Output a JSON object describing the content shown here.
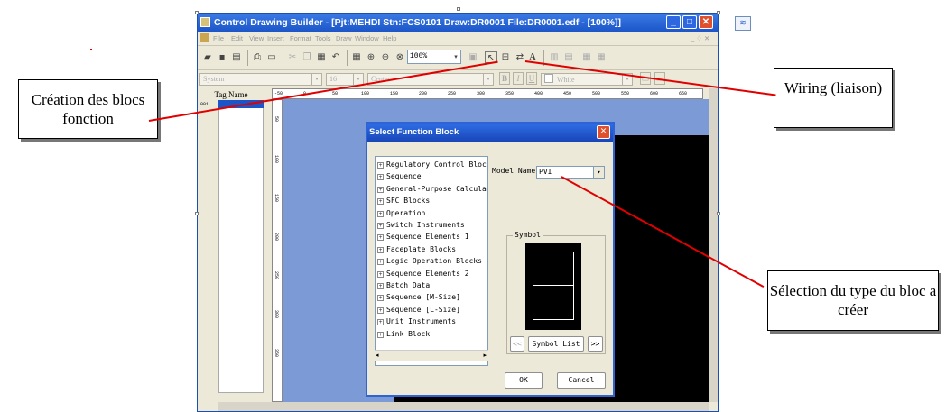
{
  "app": {
    "title": "Control Drawing Builder - [Pjt:MEHDI Stn:FCS0101 Draw:DR0001 File:DR0001.edf - [100%]]",
    "menu": [
      "File",
      "Edit",
      "View",
      "Insert",
      "Format",
      "Tools",
      "Draw",
      "Window",
      "Help"
    ],
    "zoom": "100%",
    "font_name": "System",
    "font_size": "16",
    "align": "Center",
    "color": "White",
    "bold": "B",
    "italic": "I",
    "underline": "U"
  },
  "tag_panel": {
    "header": "Tag Name",
    "first_row_number": "001"
  },
  "ruler": {
    "top": [
      "-50",
      "0",
      "50",
      "100",
      "150",
      "200",
      "250",
      "300",
      "350",
      "400",
      "450",
      "500",
      "550",
      "600",
      "650"
    ],
    "left": [
      "50",
      "100",
      "150",
      "200",
      "250",
      "300",
      "350"
    ]
  },
  "dialog": {
    "title": "Select Function Block",
    "tree_items": [
      "Regulatory Control Block",
      "Sequence",
      "General-Purpose Calculat",
      "SFC Blocks",
      "Operation",
      "Switch Instruments",
      "Sequence Elements 1",
      "Faceplate Blocks",
      "Logic Operation Blocks",
      "Sequence Elements 2",
      "Batch Data",
      "Sequence [M-Size]",
      "Sequence [L-Size]",
      "Unit Instruments",
      "Link Block"
    ],
    "model_label": "Model Name",
    "model_value": "PVI",
    "symbol_label": "Symbol",
    "prev_label": "<<",
    "symbol_list_label": "Symbol List",
    "next_label": ">>",
    "ok_label": "OK",
    "cancel_label": "Cancel"
  },
  "callouts": {
    "creation": "Création des blocs fonction",
    "wiring": "Wiring (liaison)",
    "selection": "Sélection du type du bloc a créer"
  },
  "colors": {
    "title_bar": "#1c55c8",
    "canvas_bg": "#7b9ad6",
    "arrow": "#e00000"
  }
}
